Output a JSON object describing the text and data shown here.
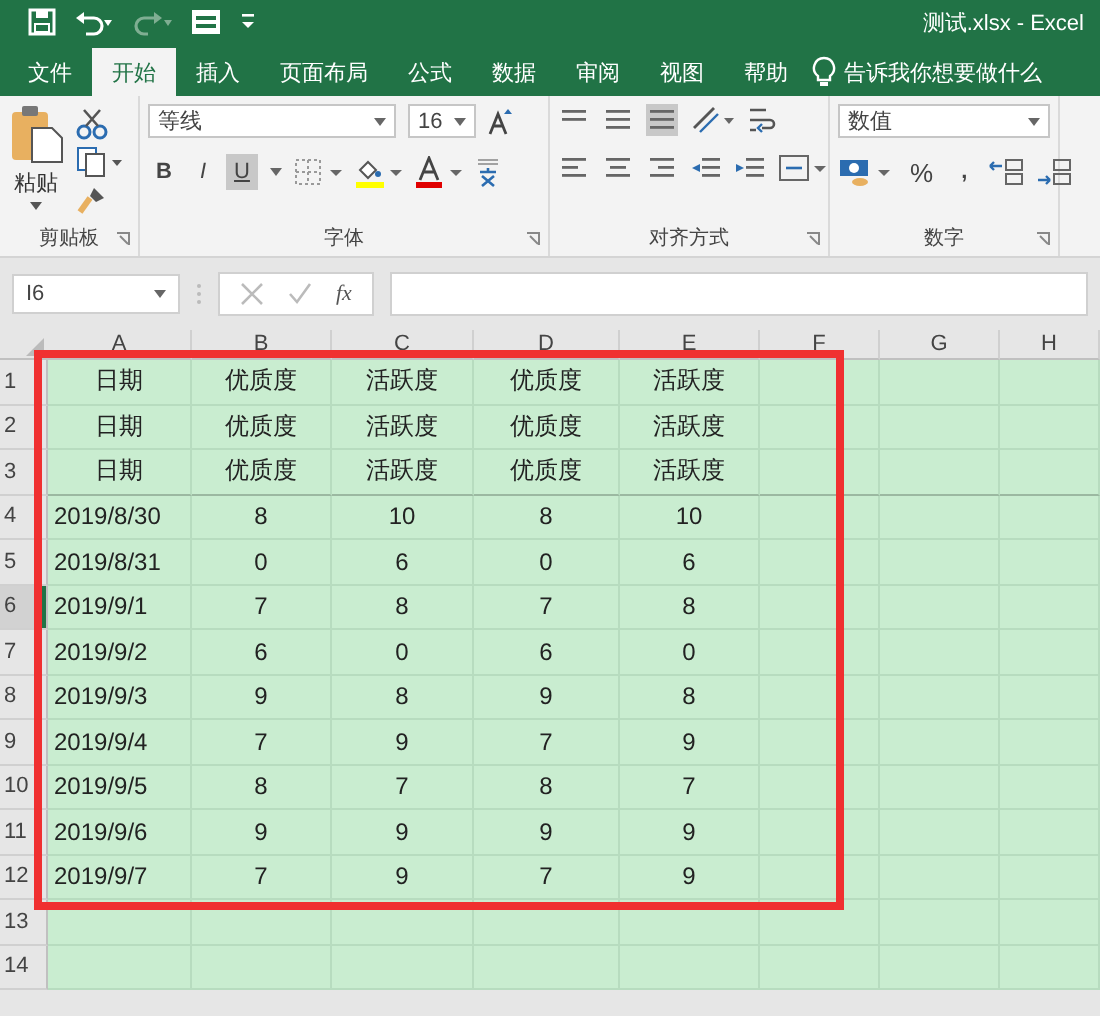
{
  "window": {
    "title": "测试.xlsx  -  Excel"
  },
  "tabs": [
    {
      "label": "文件",
      "selected": false
    },
    {
      "label": "开始",
      "selected": true
    },
    {
      "label": "插入",
      "selected": false
    },
    {
      "label": "页面布局",
      "selected": false
    },
    {
      "label": "公式",
      "selected": false
    },
    {
      "label": "数据",
      "selected": false
    },
    {
      "label": "审阅",
      "selected": false
    },
    {
      "label": "视图",
      "selected": false
    },
    {
      "label": "帮助",
      "selected": false
    }
  ],
  "tell_me": {
    "placeholder": "告诉我你想要做什么"
  },
  "ribbon": {
    "paste_label": "粘贴",
    "font_name": "等线",
    "font_size": "16",
    "bold": "B",
    "italic": "I",
    "underline": {
      "label": "U",
      "selected": true
    },
    "number_format": "数值",
    "percent": "%",
    "comma": ",",
    "groups": [
      "剪贴板",
      "字体",
      "对齐方式",
      "数字"
    ]
  },
  "formula_bar": {
    "name_box": "I6",
    "fx": "fx"
  },
  "sheet": {
    "columns": [
      "A",
      "B",
      "C",
      "D",
      "E",
      "F",
      "G",
      "H"
    ],
    "rows": [
      {
        "number": "1",
        "kind": "header",
        "selected": false,
        "cells": [
          "日期",
          "优质度",
          "活跃度",
          "优质度",
          "活跃度"
        ]
      },
      {
        "number": "2",
        "kind": "header",
        "selected": false,
        "cells": [
          "日期",
          "优质度",
          "活跃度",
          "优质度",
          "活跃度"
        ]
      },
      {
        "number": "3",
        "kind": "header",
        "selected": false,
        "cells": [
          "日期",
          "优质度",
          "活跃度",
          "优质度",
          "活跃度"
        ]
      },
      {
        "number": "4",
        "kind": "data",
        "selected": false,
        "cells": [
          "2019/8/30",
          "8",
          "10",
          "8",
          "10"
        ]
      },
      {
        "number": "5",
        "kind": "data",
        "selected": false,
        "cells": [
          "2019/8/31",
          "0",
          "6",
          "0",
          "6"
        ]
      },
      {
        "number": "6",
        "kind": "data",
        "selected": true,
        "cells": [
          "2019/9/1",
          "7",
          "8",
          "7",
          "8"
        ]
      },
      {
        "number": "7",
        "kind": "data",
        "selected": false,
        "cells": [
          "2019/9/2",
          "6",
          "0",
          "6",
          "0"
        ]
      },
      {
        "number": "8",
        "kind": "data",
        "selected": false,
        "cells": [
          "2019/9/3",
          "9",
          "8",
          "9",
          "8"
        ]
      },
      {
        "number": "9",
        "kind": "data",
        "selected": false,
        "cells": [
          "2019/9/4",
          "7",
          "9",
          "7",
          "9"
        ]
      },
      {
        "number": "10",
        "kind": "data",
        "selected": false,
        "cells": [
          "2019/9/5",
          "8",
          "7",
          "8",
          "7"
        ]
      },
      {
        "number": "11",
        "kind": "data",
        "selected": false,
        "cells": [
          "2019/9/6",
          "9",
          "9",
          "9",
          "9"
        ]
      },
      {
        "number": "12",
        "kind": "data",
        "selected": false,
        "cells": [
          "2019/9/7",
          "7",
          "9",
          "7",
          "9"
        ]
      },
      {
        "number": "13",
        "kind": "empty",
        "selected": false,
        "cells": []
      },
      {
        "number": "14",
        "kind": "empty",
        "selected": false,
        "cells": []
      }
    ]
  }
}
